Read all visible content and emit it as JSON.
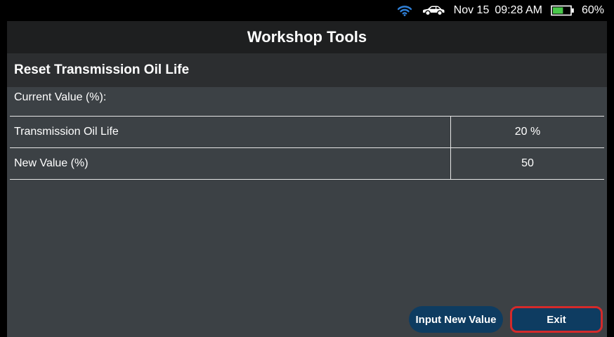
{
  "status_bar": {
    "wifi_icon": "wifi-icon",
    "car_icon": "car-icon",
    "date": "Nov 15",
    "time": "09:28 AM",
    "battery_level": 0.6,
    "battery_text": "60%",
    "battery_color": "#49c84a",
    "wifi_color": "#2f7fd6"
  },
  "app": {
    "title": "Workshop Tools",
    "section_title": "Reset Transmission Oil Life",
    "current_label": "Current Value (%):",
    "rows": [
      {
        "name": "Transmission Oil Life",
        "value": "20 %"
      },
      {
        "name": "New Value (%)",
        "value": "50"
      }
    ]
  },
  "buttons": {
    "input_new_value": "Input New Value",
    "exit": "Exit",
    "exit_highlight_color": "#d42a2a"
  }
}
